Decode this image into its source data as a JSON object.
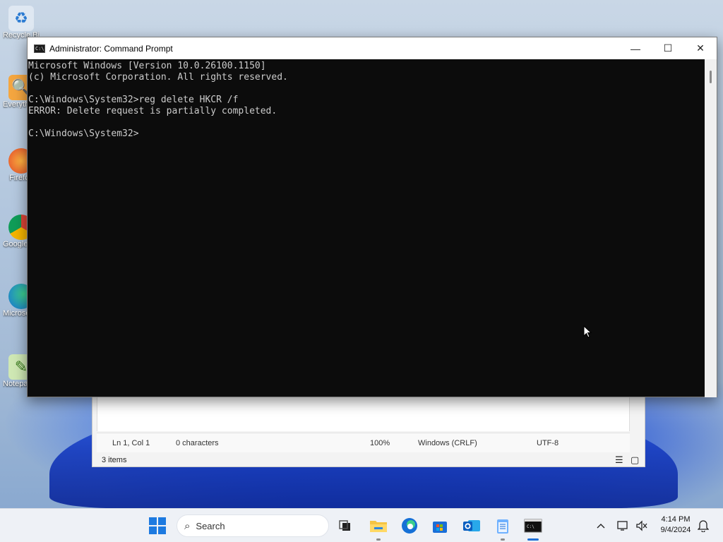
{
  "desktop": {
    "icons": [
      {
        "label": "Recycle Bin",
        "icon": "recycle-bin-icon"
      },
      {
        "label": "Everything",
        "icon": "everything-search-icon"
      },
      {
        "label": "Firefox",
        "icon": "firefox-icon"
      },
      {
        "label": "Google Chrome",
        "icon": "chrome-icon"
      },
      {
        "label": "Microsoft Edge",
        "icon": "edge-icon"
      },
      {
        "label": "Notepad++",
        "icon": "notepadpp-icon"
      }
    ]
  },
  "background_window": {
    "status": {
      "position": "Ln 1, Col 1",
      "characters": "0 characters",
      "zoom": "100%",
      "line_endings": "Windows (CRLF)",
      "encoding": "UTF-8"
    },
    "items_count": "3 items"
  },
  "cmd": {
    "title": "Administrator: Command Prompt",
    "lines": [
      "Microsoft Windows [Version 10.0.26100.1150]",
      "(c) Microsoft Corporation. All rights reserved.",
      "",
      "C:\\Windows\\System32>reg delete HKCR /f",
      "ERROR: Delete request is partially completed.",
      "",
      "C:\\Windows\\System32>"
    ],
    "controls": {
      "minimize": "—",
      "maximize": "☐",
      "close": "✕"
    }
  },
  "taskbar": {
    "search_placeholder": "Search",
    "apps": [
      "task-view-icon",
      "file-explorer-icon",
      "edge-icon",
      "store-icon",
      "outlook-icon",
      "notepad-icon",
      "terminal-icon"
    ],
    "tray": {
      "chevron": "^"
    },
    "clock": {
      "time": "4:14 PM",
      "date": "9/4/2024"
    }
  },
  "colors": {
    "console_bg": "#0c0c0c",
    "console_text": "#cccccc",
    "accent": "#1d6fd6"
  }
}
